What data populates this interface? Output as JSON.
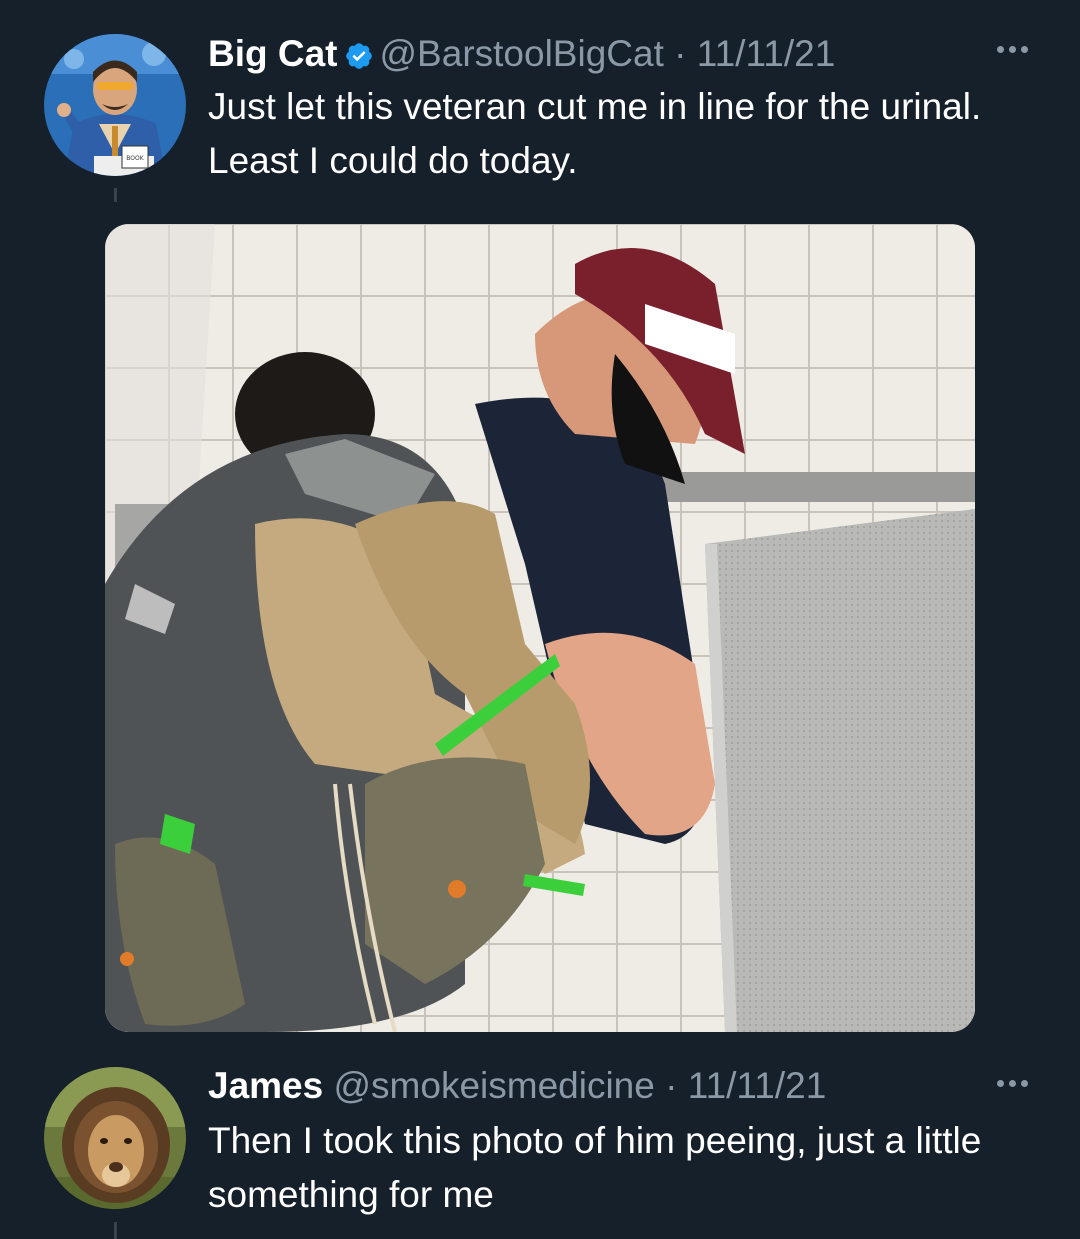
{
  "tweets": [
    {
      "display_name": "Big Cat",
      "verified": true,
      "handle": "@BarstoolBigCat",
      "separator": "·",
      "date": "11/11/21",
      "text": "Just let this veteran cut me in line for the urinal. Least I could do today.",
      "avatar_icon": "man-in-sunglasses-avatar",
      "has_photo": true,
      "photo_icon": "urinal-photo"
    },
    {
      "display_name": "James",
      "verified": false,
      "handle": "@smokeismedicine",
      "separator": "·",
      "date": "11/11/21",
      "text": "Then I took this photo of him peeing, just a little something for me",
      "avatar_icon": "lion-avatar"
    }
  ],
  "colors": {
    "background": "#15202b",
    "text_primary": "#ffffff",
    "text_secondary": "#8b98a5",
    "verified_blue": "#1d9bf0",
    "thread_line": "#38444d"
  }
}
